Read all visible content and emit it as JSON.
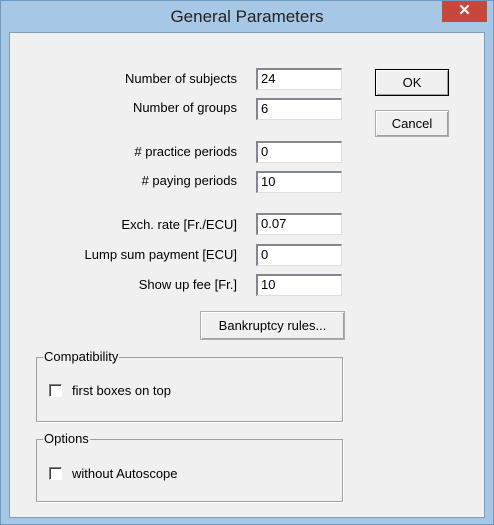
{
  "window": {
    "title": "General Parameters",
    "close_glyph": "✕"
  },
  "fields": [
    {
      "label": "Number of subjects",
      "value": "24"
    },
    {
      "label": "Number of groups",
      "value": "6"
    },
    {
      "label": "# practice periods",
      "value": "0"
    },
    {
      "label": "# paying periods",
      "value": "10"
    },
    {
      "label": "Exch. rate [Fr./ECU]",
      "value": "0.07"
    },
    {
      "label": "Lump sum payment [ECU]",
      "value": "0"
    },
    {
      "label": "Show up fee [Fr.]",
      "value": "10"
    }
  ],
  "buttons": {
    "ok": "OK",
    "cancel": "Cancel",
    "bankruptcy": "Bankruptcy rules..."
  },
  "compatibility": {
    "legend": "Compatibility",
    "checkbox_label": "first boxes on top",
    "checked": false
  },
  "options": {
    "legend": "Options",
    "checkbox_label": "without Autoscope",
    "checked": false
  }
}
